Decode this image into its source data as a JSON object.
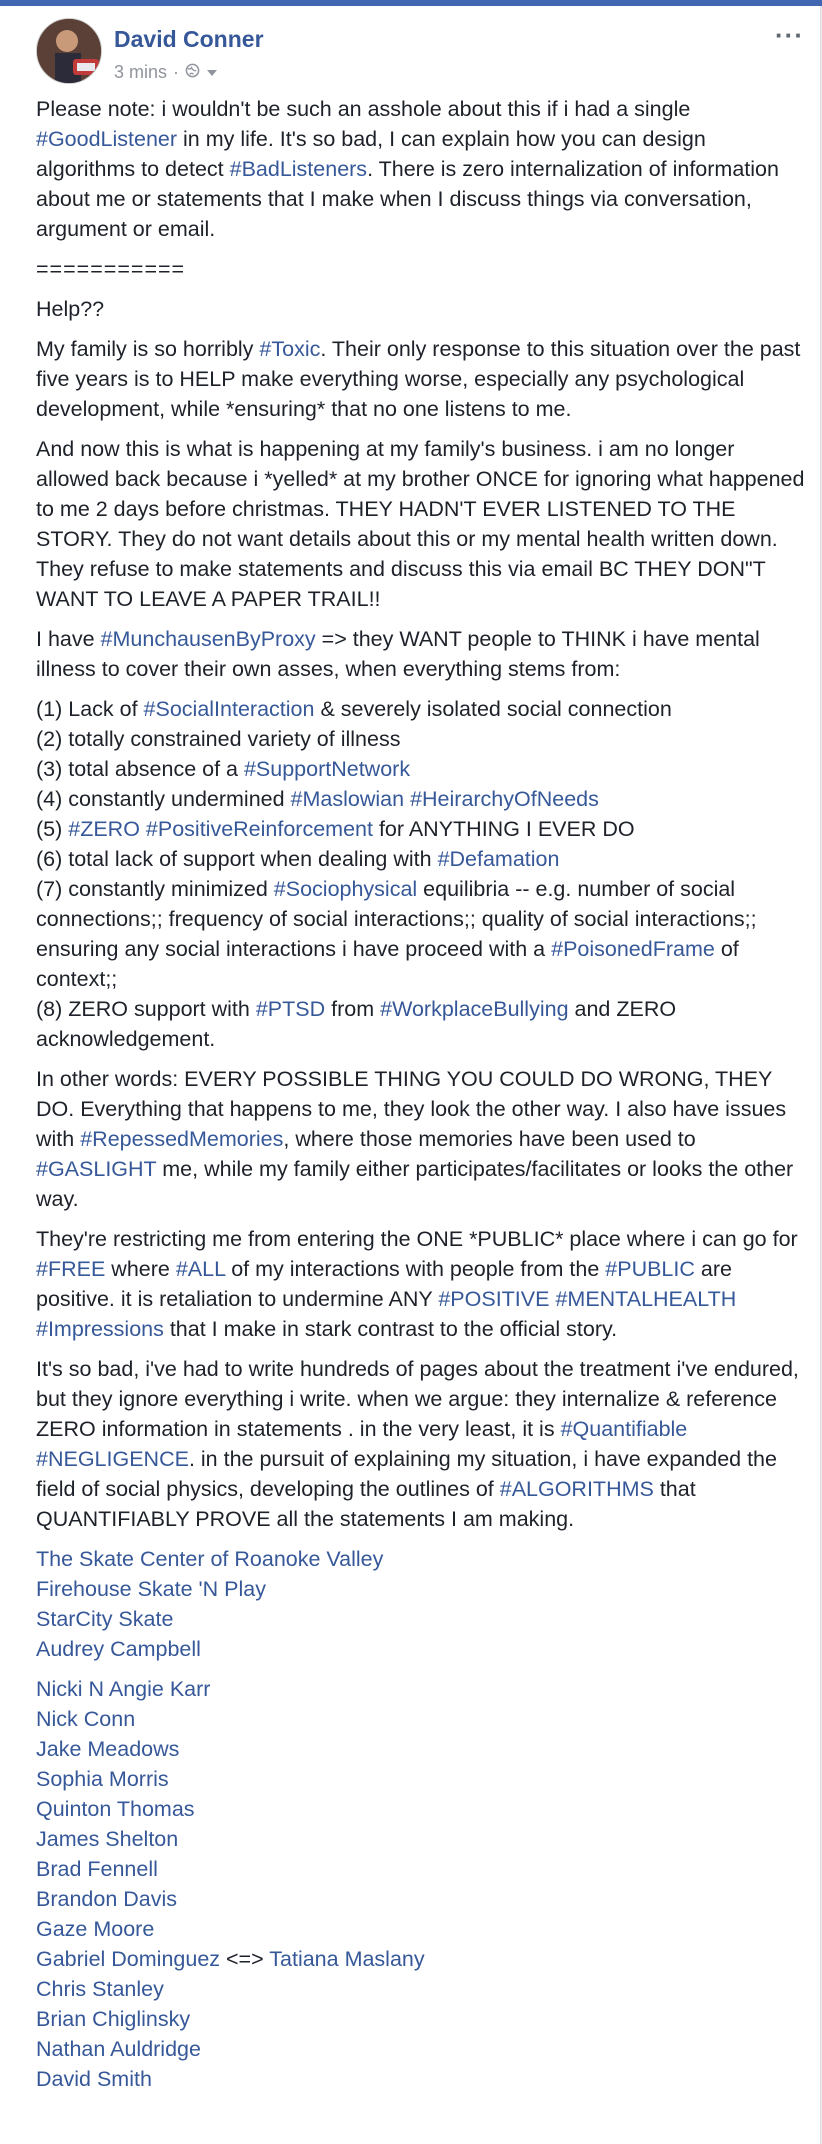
{
  "post": {
    "author": "David Conner",
    "time": "3 mins",
    "separator": "·",
    "more_label": "···"
  },
  "body": {
    "p1": {
      "t1": "Please note: i wouldn't be such an asshole about this if i had a single ",
      "h1": "#GoodListener",
      "t2": " in my life. It's so bad, I can explain how you can design algorithms to detect ",
      "h2": "#BadListeners",
      "t3": ". There is zero internalization of information about me or statements that I make when I discuss things via conversation, argument or email."
    },
    "rule": "===========",
    "help": "Help??",
    "p2": {
      "t1": "My family is so horribly ",
      "h1": "#Toxic",
      "t2": ". Their only response to this situation over the past five years is to HELP make everything worse, especially any psychological development, while *ensuring* that no one listens to me."
    },
    "p3": "And now this is what is happening at my family's business. i am no longer allowed back because i *yelled* at my brother ONCE for ignoring what happened to me 2 days before christmas. THEY HADN'T EVER LISTENED TO THE STORY. They do not want details about this or my mental health written down. They refuse to make statements and discuss this via email BC THEY DON\"T WANT TO LEAVE A PAPER TRAIL!!",
    "p4": {
      "t1": "I have ",
      "h1": "#MunchausenByProxy",
      "t2": " => they WANT people to THINK i have mental illness to cover their own asses, when everything stems from:"
    },
    "list": {
      "i1": {
        "t1": "(1) Lack of ",
        "h1": "#SocialInteraction",
        "t2": " & severely isolated social connection"
      },
      "i2": {
        "t1": "(2) totally constrained variety of illness"
      },
      "i3": {
        "t1": "(3) total absence of a ",
        "h1": "#SupportNetwork"
      },
      "i4": {
        "t1": "(4) constantly undermined ",
        "h1": "#Maslowian",
        "t2": " ",
        "h2": "#HeirarchyOfNeeds"
      },
      "i5": {
        "t1": "(5) ",
        "h1": "#ZERO",
        "t2": " ",
        "h2": "#PositiveReinforcement",
        "t3": " for ANYTHING I EVER DO"
      },
      "i6": {
        "t1": "(6) total lack of support when dealing with ",
        "h1": "#Defamation"
      },
      "i7": {
        "t1": "(7) constantly minimized ",
        "h1": "#Sociophysical",
        "t2": " equilibria -- e.g. number of social connections;; frequency of social interactions;; quality of social interactions;; ensuring any social interactions i have proceed with a ",
        "h2": "#PoisonedFrame",
        "t3": " of context;;"
      },
      "i8": {
        "t1": "(8) ZERO support with ",
        "h1": "#PTSD",
        "t2": " from ",
        "h2": "#WorkplaceBullying",
        "t3": " and ZERO acknowledgement."
      }
    },
    "p5": {
      "t1": "In other words: EVERY POSSIBLE THING YOU COULD DO WRONG, THEY DO. Everything that happens to me, they look the other way. I also have issues with ",
      "h1": "#RepessedMemories",
      "t2": ", where those memories have been used to ",
      "h2": "#GASLIGHT",
      "t3": " me, while my family either participates/facilitates or looks the other way."
    },
    "p6": {
      "t1": "They're restricting me from entering the ONE *PUBLIC* place where i can go for ",
      "h1": "#FREE",
      "t2": " where ",
      "h2": "#ALL",
      "t3": " of my interactions with people from the ",
      "h3": "#PUBLIC",
      "t4": " are positive. it is retaliation to undermine ANY ",
      "h4": "#POSITIVE",
      "t5": " ",
      "h5": "#MENTALHEALTH",
      "t6": " ",
      "h6": "#Impressions",
      "t7": " that I make in stark contrast to the official story."
    },
    "p7": {
      "t1": "It's so bad, i've had to write hundreds of pages about the treatment i've endured, but they ignore everything i write. when we argue: they internalize & reference ZERO information in statements . in the very least, it is ",
      "h1": "#Quantifiable",
      "t2": " ",
      "h2": "#NEGLIGENCE",
      "t3": ". in the pursuit of explaining my situation, i have expanded the field of social physics, developing the outlines of ",
      "h3": "#ALGORITHMS",
      "t4": " that QUANTIFIABLY PROVE all the statements I am making."
    }
  },
  "tagged_pages": [
    "The Skate Center of Roanoke Valley",
    "Firehouse Skate 'N Play",
    "StarCity Skate",
    "Audrey Campbell"
  ],
  "tagged_people": {
    "n1": "Nicki N Angie Karr",
    "n2": "Nick Conn",
    "n3": "Jake Meadows",
    "n4": "Sophia Morris",
    "n5": "Quinton Thomas",
    "n6": "James Shelton",
    "n7": "Brad Fennell",
    "n8": "Brandon Davis",
    "n9": "Gaze Moore",
    "n10a": "Gabriel Dominguez",
    "n10sep": " <=> ",
    "n10b": "Tatiana Maslany",
    "n11": "Chris Stanley",
    "n12": "Brian Chiglinsky",
    "n13": "Nathan Auldridge",
    "n14": "David Smith"
  },
  "colors": {
    "link": "#365899",
    "text": "#1d2129",
    "meta": "#90949c",
    "bar": "#4267b2"
  },
  "icons": [
    "avatar",
    "globe-icon",
    "chevron-down-icon",
    "more-icon"
  ]
}
